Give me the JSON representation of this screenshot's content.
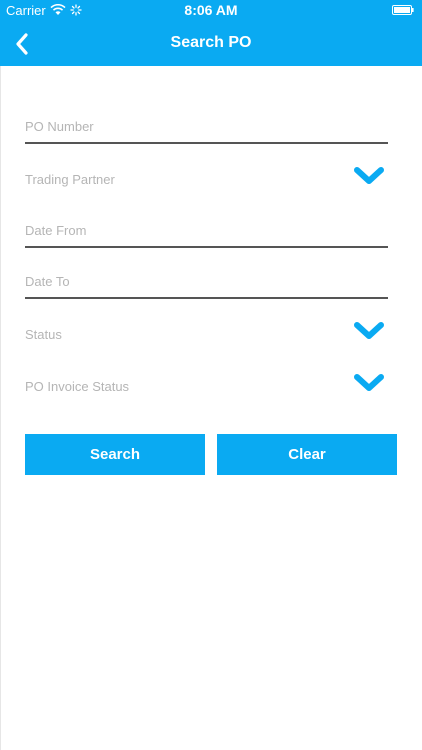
{
  "status_bar": {
    "carrier": "Carrier",
    "time": "8:06 AM"
  },
  "header": {
    "title": "Search PO",
    "back_icon": "chevron-left-icon"
  },
  "form": {
    "po_number": {
      "placeholder": "PO Number",
      "value": ""
    },
    "trading_partner": {
      "label": "Trading Partner"
    },
    "date_from": {
      "placeholder": "Date From",
      "value": ""
    },
    "date_to": {
      "placeholder": "Date To",
      "value": ""
    },
    "status": {
      "label": "Status"
    },
    "po_invoice_status": {
      "label": "PO Invoice Status"
    }
  },
  "actions": {
    "search_label": "Search",
    "clear_label": "Clear"
  },
  "colors": {
    "accent": "#0aaaf2",
    "placeholder": "#b5b5b5",
    "underline": "#555555"
  }
}
